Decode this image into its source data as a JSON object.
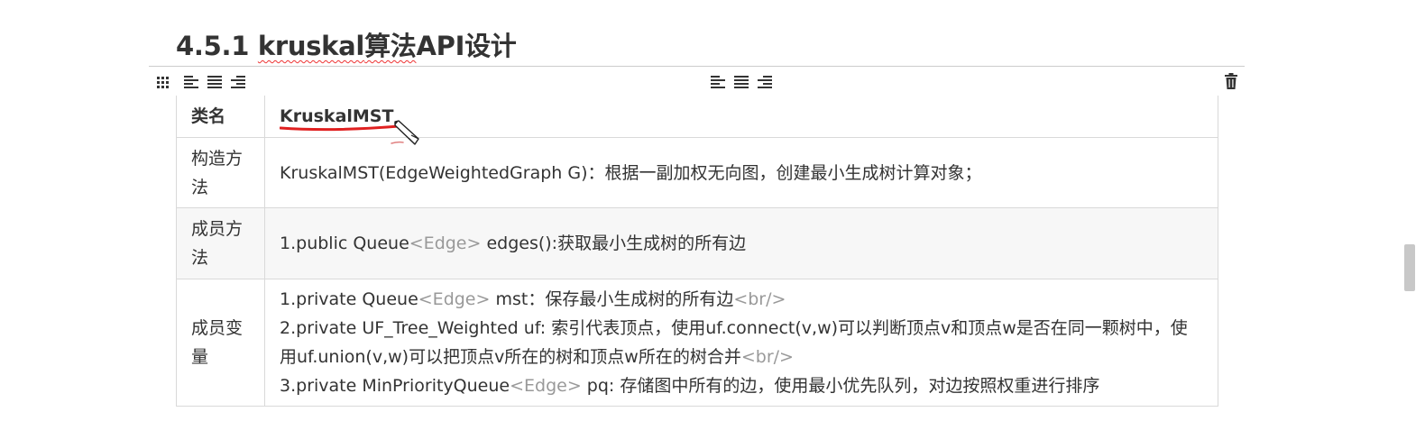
{
  "heading": {
    "prefix": "4.5.1 ",
    "kruskal": "kruskal",
    "suffix_zh": "算法",
    "api": "API",
    "suffix2": "设计"
  },
  "toolbar": {
    "icons": [
      "grid-icon",
      "align-left-icon",
      "align-center-icon",
      "align-right-icon",
      "align-left-icon",
      "align-center-icon",
      "align-right-icon",
      "trash-icon"
    ]
  },
  "table": {
    "header": {
      "label": "类名",
      "value": "KruskalMST"
    },
    "rows": [
      {
        "label": "构造方法",
        "lines": [
          {
            "parts": [
              {
                "text": "KruskalMST(EdgeWeightedGraph G)：根据一副加权无向图，创建最小生成树计算对象；",
                "tag": false
              }
            ]
          }
        ]
      },
      {
        "label": "成员方法",
        "lines": [
          {
            "parts": [
              {
                "text": "1.public Queue",
                "tag": false
              },
              {
                "text": "<Edge>",
                "tag": true
              },
              {
                "text": " edges():获取最小生成树的所有边",
                "tag": false
              }
            ]
          }
        ]
      },
      {
        "label": "成员变量",
        "lines": [
          {
            "parts": [
              {
                "text": "1.private Queue",
                "tag": false
              },
              {
                "text": "<Edge>",
                "tag": true
              },
              {
                "text": " mst：保存最小生成树的所有边",
                "tag": false
              },
              {
                "text": "<br/>",
                "tag": true
              }
            ]
          },
          {
            "parts": [
              {
                "text": "2.private UF_Tree_Weighted uf: 索引代表顶点，使用uf.connect(v,w)可以判断顶点v和顶点w是否在同一颗树中，使用uf.union(v,w)可以把顶点v所在的树和顶点w所在的树合并",
                "tag": false
              },
              {
                "text": "<br/>",
                "tag": true
              }
            ]
          },
          {
            "parts": [
              {
                "text": "3.private MinPriorityQueue",
                "tag": false
              },
              {
                "text": "<Edge>",
                "tag": true
              },
              {
                "text": " pq: 存储图中所有的边，使用最小优先队列，对边按照权重进行排序",
                "tag": false
              }
            ]
          }
        ]
      }
    ]
  }
}
